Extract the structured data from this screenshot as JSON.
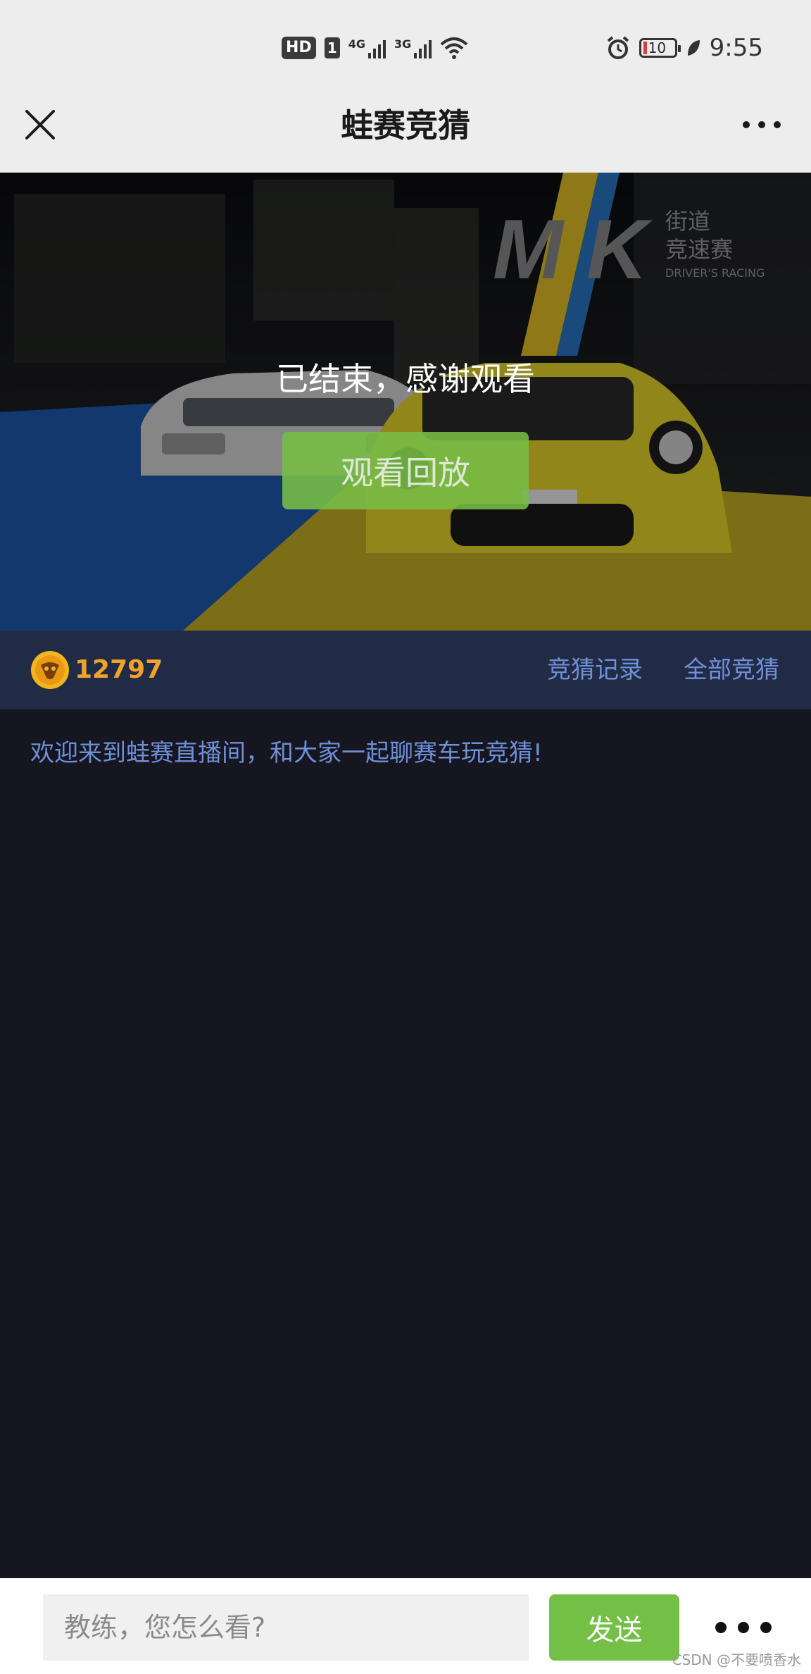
{
  "status_bar": {
    "hd": "HD",
    "sim": "1",
    "net1": "4G",
    "net2": "3G",
    "battery": "10",
    "time": "9:55"
  },
  "header": {
    "title": "蛙赛竞猜"
  },
  "video": {
    "status_text": "已结束，感谢观看",
    "replay_label": "观看回放",
    "logo_text": "M K",
    "logo_cn_line1": "街道",
    "logo_cn_line2": "竞速赛",
    "logo_sub": "DRIVER'S RACING"
  },
  "info_bar": {
    "coins": "12797",
    "records_label": "竞猜记录",
    "all_label": "全部竞猜"
  },
  "chat": {
    "welcome": "欢迎来到蛙赛直播间，和大家一起聊赛车玩竞猜!"
  },
  "input_bar": {
    "placeholder": "教练，您怎么看?",
    "send_label": "发送"
  },
  "watermark": "CSDN @不要喷香水",
  "colors": {
    "accent_green": "#74bf45",
    "link_blue": "#6f8fd8",
    "coin_gold": "#f0a32a",
    "info_bar_bg": "#222b45"
  }
}
